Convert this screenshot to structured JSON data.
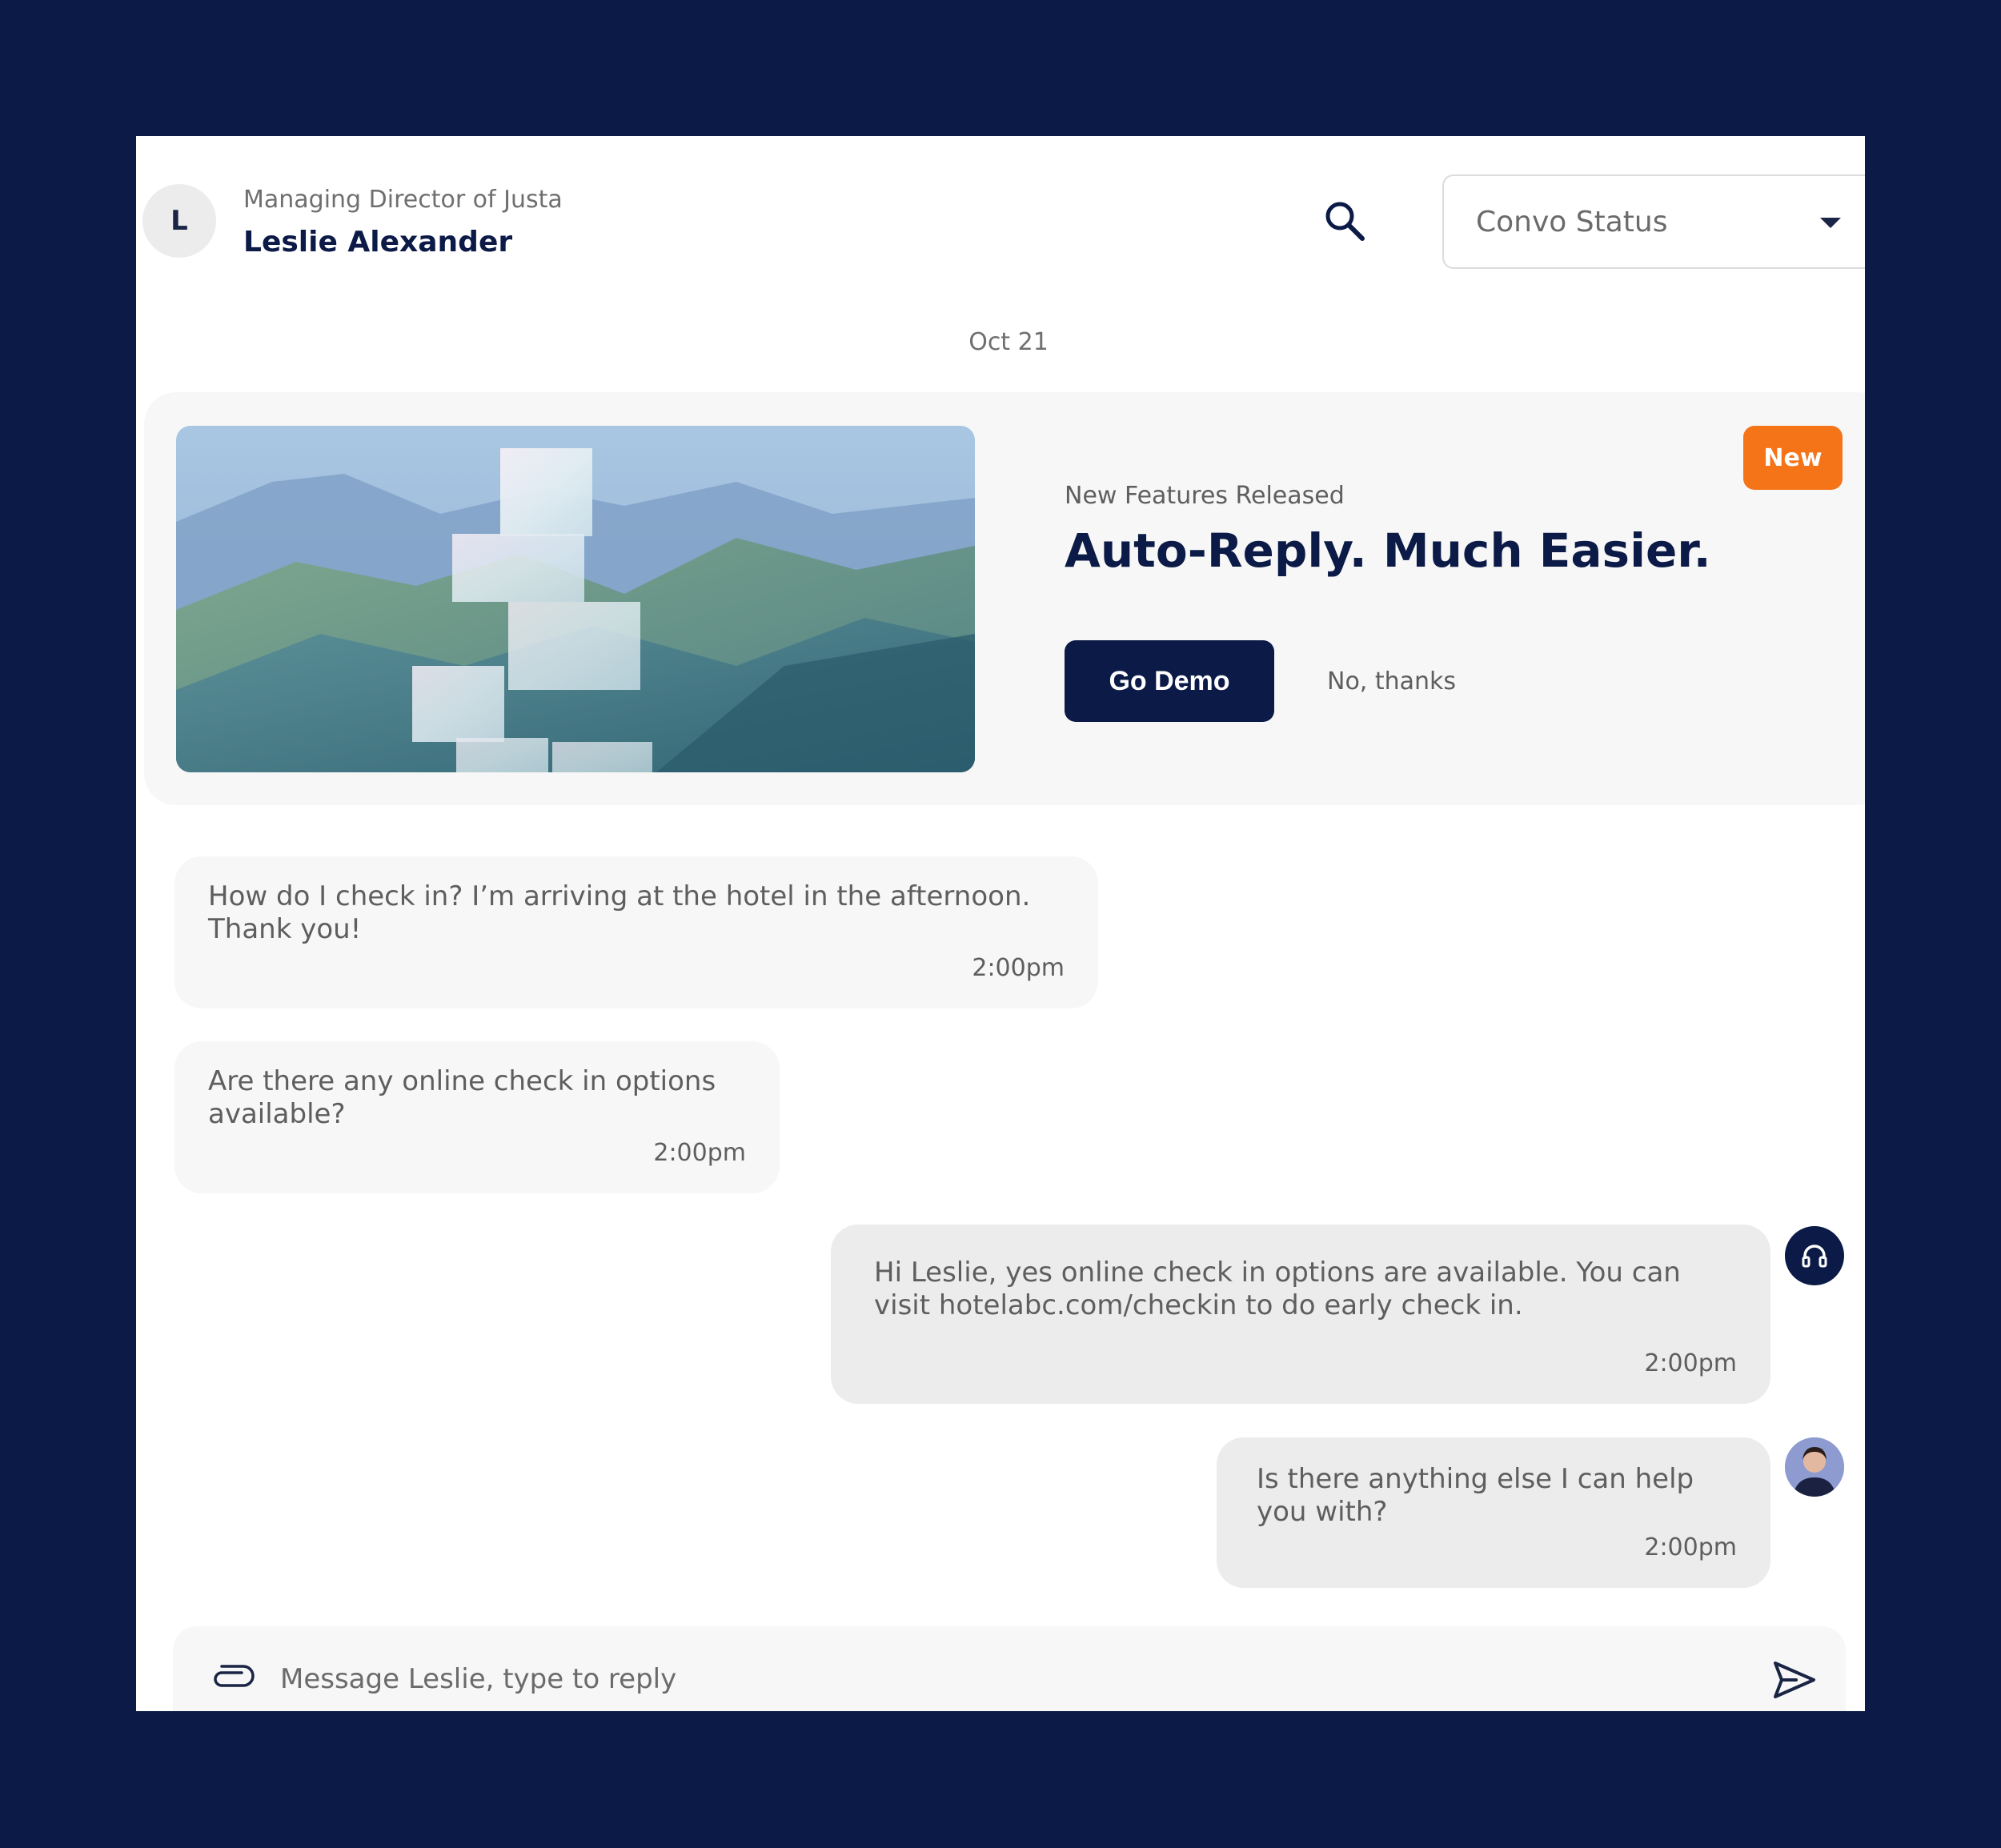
{
  "header": {
    "avatar_initial": "L",
    "contact_role": "Managing Director of Justa",
    "contact_name": "Leslie Alexander",
    "status_select": {
      "selected": "Convo Status"
    }
  },
  "date_separator": "Oct 21",
  "promo": {
    "subtitle": "New Features Released",
    "title": "Auto-Reply. Much Easier.",
    "primary_button": "Go Demo",
    "secondary_link": "No, thanks",
    "badge": "New"
  },
  "messages": [
    {
      "direction": "incoming",
      "text": "How do I check in? I’m arriving at the hotel in the afternoon. Thank you!",
      "time": "2:00pm"
    },
    {
      "direction": "incoming",
      "text": "Are there any online check in options available?",
      "time": "2:00pm"
    },
    {
      "direction": "outgoing",
      "sender": "agent",
      "text": "Hi Leslie, yes online check in options are available. You can visit hotelabc.com/checkin to do early check in.",
      "time": "2:00pm"
    },
    {
      "direction": "outgoing",
      "sender": "user",
      "text": "Is there anything else I can help you with?",
      "time": "2:00pm"
    }
  ],
  "composer": {
    "placeholder": "Message Leslie, type to reply"
  },
  "icons": {
    "search": "search-icon",
    "dropdown": "chevron-down-icon",
    "attach": "paperclip-icon",
    "send": "send-icon",
    "agent": "headset-icon"
  },
  "colors": {
    "frame": "#0b1a46",
    "primary": "#0b1a46",
    "accent": "#f57418",
    "incoming_bubble": "#f7f7f7",
    "outgoing_bubble": "#ececec"
  }
}
